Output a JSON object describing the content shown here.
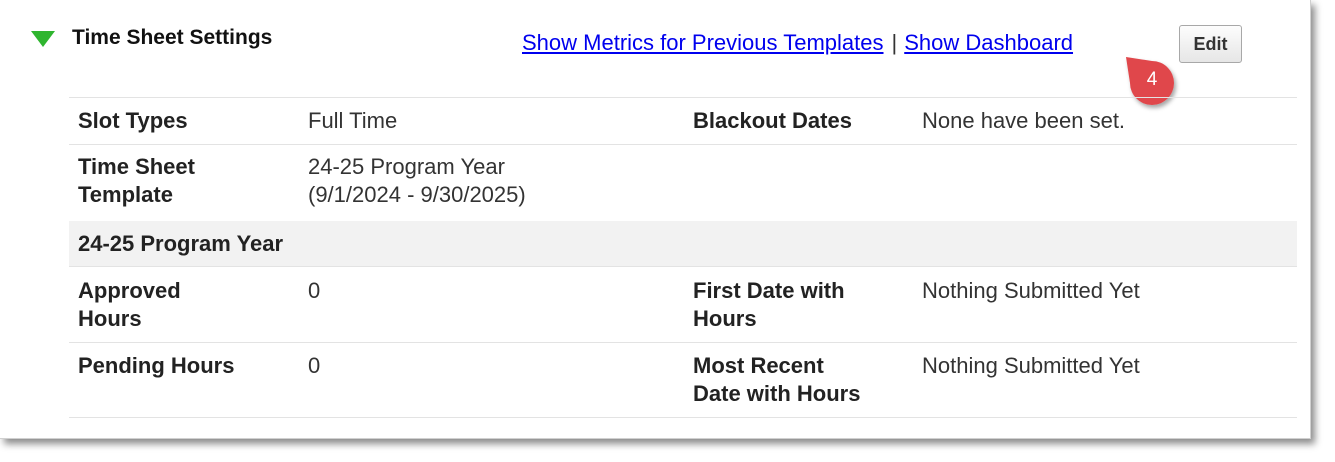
{
  "header": {
    "title": "Time Sheet Settings",
    "toggle_icon": "triangle-down-icon",
    "toggle_color": "#2fb52f"
  },
  "links": {
    "metrics": "Show Metrics for Previous Templates",
    "separator": "|",
    "dashboard": "Show Dashboard"
  },
  "edit_button": {
    "label": "Edit"
  },
  "callout": {
    "number": "4",
    "color": "#e0474c"
  },
  "settings": {
    "slot_types_label": "Slot Types",
    "slot_types_value": "Full Time",
    "blackout_label": "Blackout Dates",
    "blackout_value": "None have been set.",
    "template_label_line1": "Time Sheet",
    "template_label_line2": "Template",
    "template_value_line1": "24-25 Program Year",
    "template_value_line2": "(9/1/2024 - 9/30/2025)"
  },
  "program_year": {
    "heading": "24-25 Program Year",
    "approved_label_line1": "Approved",
    "approved_label_line2": "Hours",
    "approved_value": "0",
    "first_date_label_line1": "First Date with",
    "first_date_label_line2": "Hours",
    "first_date_value": "Nothing Submitted Yet",
    "pending_label": "Pending Hours",
    "pending_value": "0",
    "recent_date_label_line1": "Most Recent",
    "recent_date_label_line2": "Date with Hours",
    "recent_date_value": "Nothing Submitted Yet"
  }
}
